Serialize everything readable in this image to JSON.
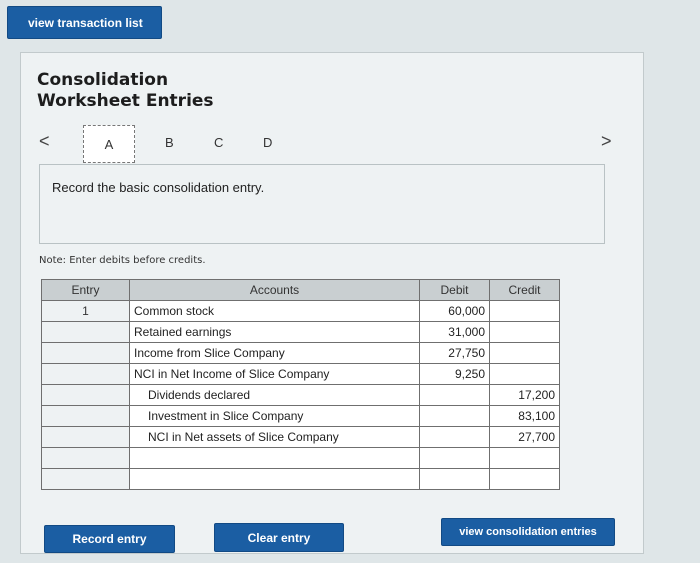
{
  "top_button": "view transaction list",
  "title_line1": "Consolidation",
  "title_line2": "Worksheet Entries",
  "nav": {
    "prev": "<",
    "next": ">"
  },
  "tabs": [
    "A",
    "B",
    "C",
    "D"
  ],
  "instruction": "Record the basic consolidation entry.",
  "note": "Note: Enter debits before credits.",
  "table": {
    "headers": {
      "entry": "Entry",
      "accounts": "Accounts",
      "debit": "Debit",
      "credit": "Credit"
    },
    "rows": [
      {
        "entry": "1",
        "account": "Common stock",
        "debit": "60,000",
        "credit": ""
      },
      {
        "entry": "",
        "account": "Retained earnings",
        "debit": "31,000",
        "credit": ""
      },
      {
        "entry": "",
        "account": "Income from Slice Company",
        "debit": "27,750",
        "credit": ""
      },
      {
        "entry": "",
        "account": "NCI in Net Income of Slice Company",
        "debit": "9,250",
        "credit": ""
      },
      {
        "entry": "",
        "account": "Dividends declared",
        "debit": "",
        "credit": "17,200"
      },
      {
        "entry": "",
        "account": "Investment in Slice Company",
        "debit": "",
        "credit": "83,100"
      },
      {
        "entry": "",
        "account": "NCI in Net assets of Slice Company",
        "debit": "",
        "credit": "27,700"
      },
      {
        "entry": "",
        "account": "",
        "debit": "",
        "credit": ""
      },
      {
        "entry": "",
        "account": "",
        "debit": "",
        "credit": ""
      }
    ]
  },
  "buttons": {
    "record": "Record entry",
    "clear": "Clear entry",
    "view_consolidation": "view consolidation entries"
  }
}
